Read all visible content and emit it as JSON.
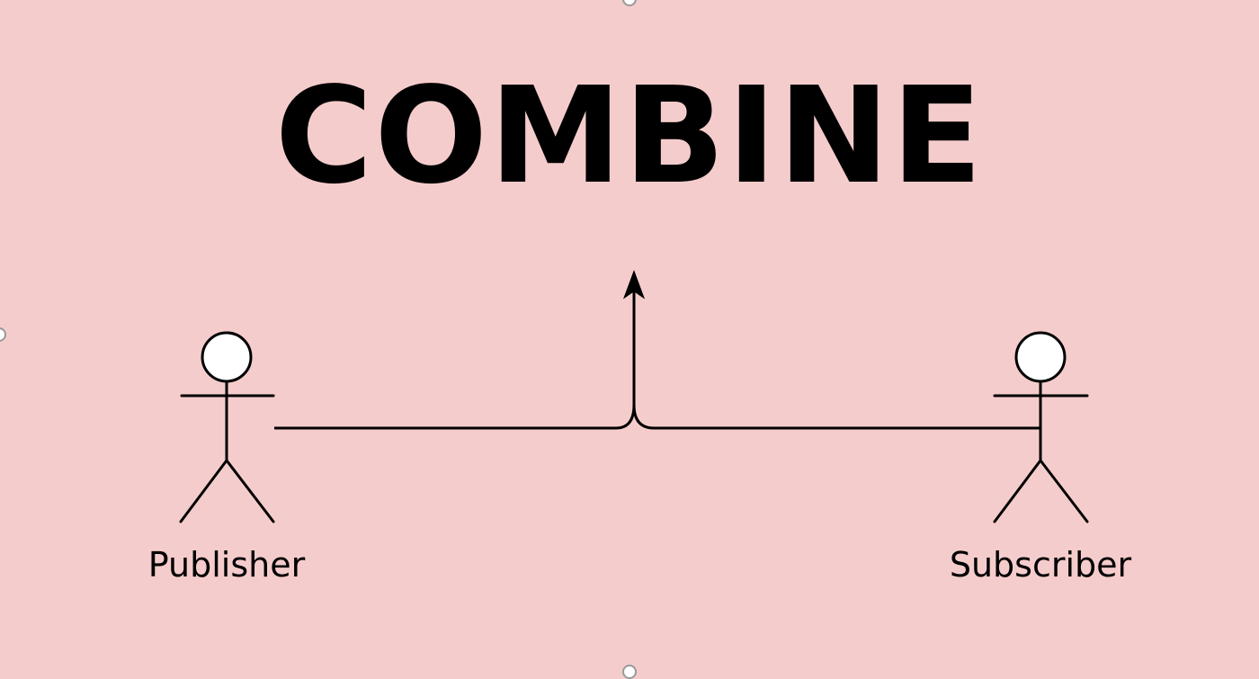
{
  "diagram": {
    "title": "COMBINE",
    "actors": [
      {
        "id": "publisher",
        "label": "Publisher"
      },
      {
        "id": "subscriber",
        "label": "Subscriber"
      }
    ]
  },
  "colors": {
    "background": "#f5cccc",
    "ink": "#000000",
    "head_fill": "#ffffff"
  }
}
